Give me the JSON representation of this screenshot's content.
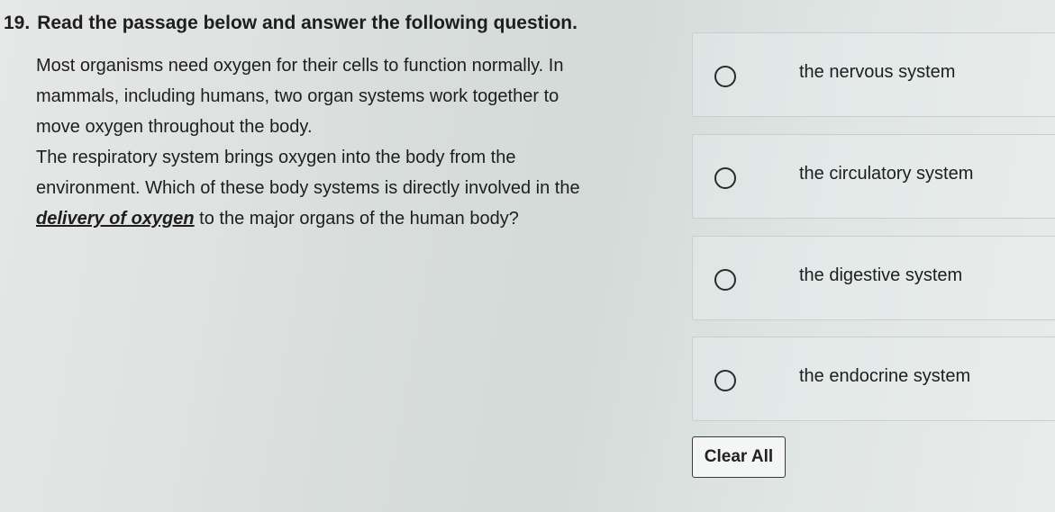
{
  "question": {
    "number": "19.",
    "instruction": "Read the passage below and answer the following question."
  },
  "passage": {
    "lines": [
      "Most organisms need oxygen for their cells to function normally. In",
      "mammals, including humans, two organ systems work together to",
      "move oxygen throughout the body.",
      "The respiratory system brings oxygen into the body from the",
      "environment. Which of these body systems is directly involved in the"
    ],
    "emphasis": "delivery of oxygen",
    "last_line_rest": " to the major organs of the human body?"
  },
  "options": [
    {
      "label": "the nervous system",
      "selected": false
    },
    {
      "label": "the circulatory system",
      "selected": false
    },
    {
      "label": "the digestive system",
      "selected": false
    },
    {
      "label": "the endocrine system",
      "selected": false
    }
  ],
  "clear_button": {
    "label": "Clear All"
  }
}
